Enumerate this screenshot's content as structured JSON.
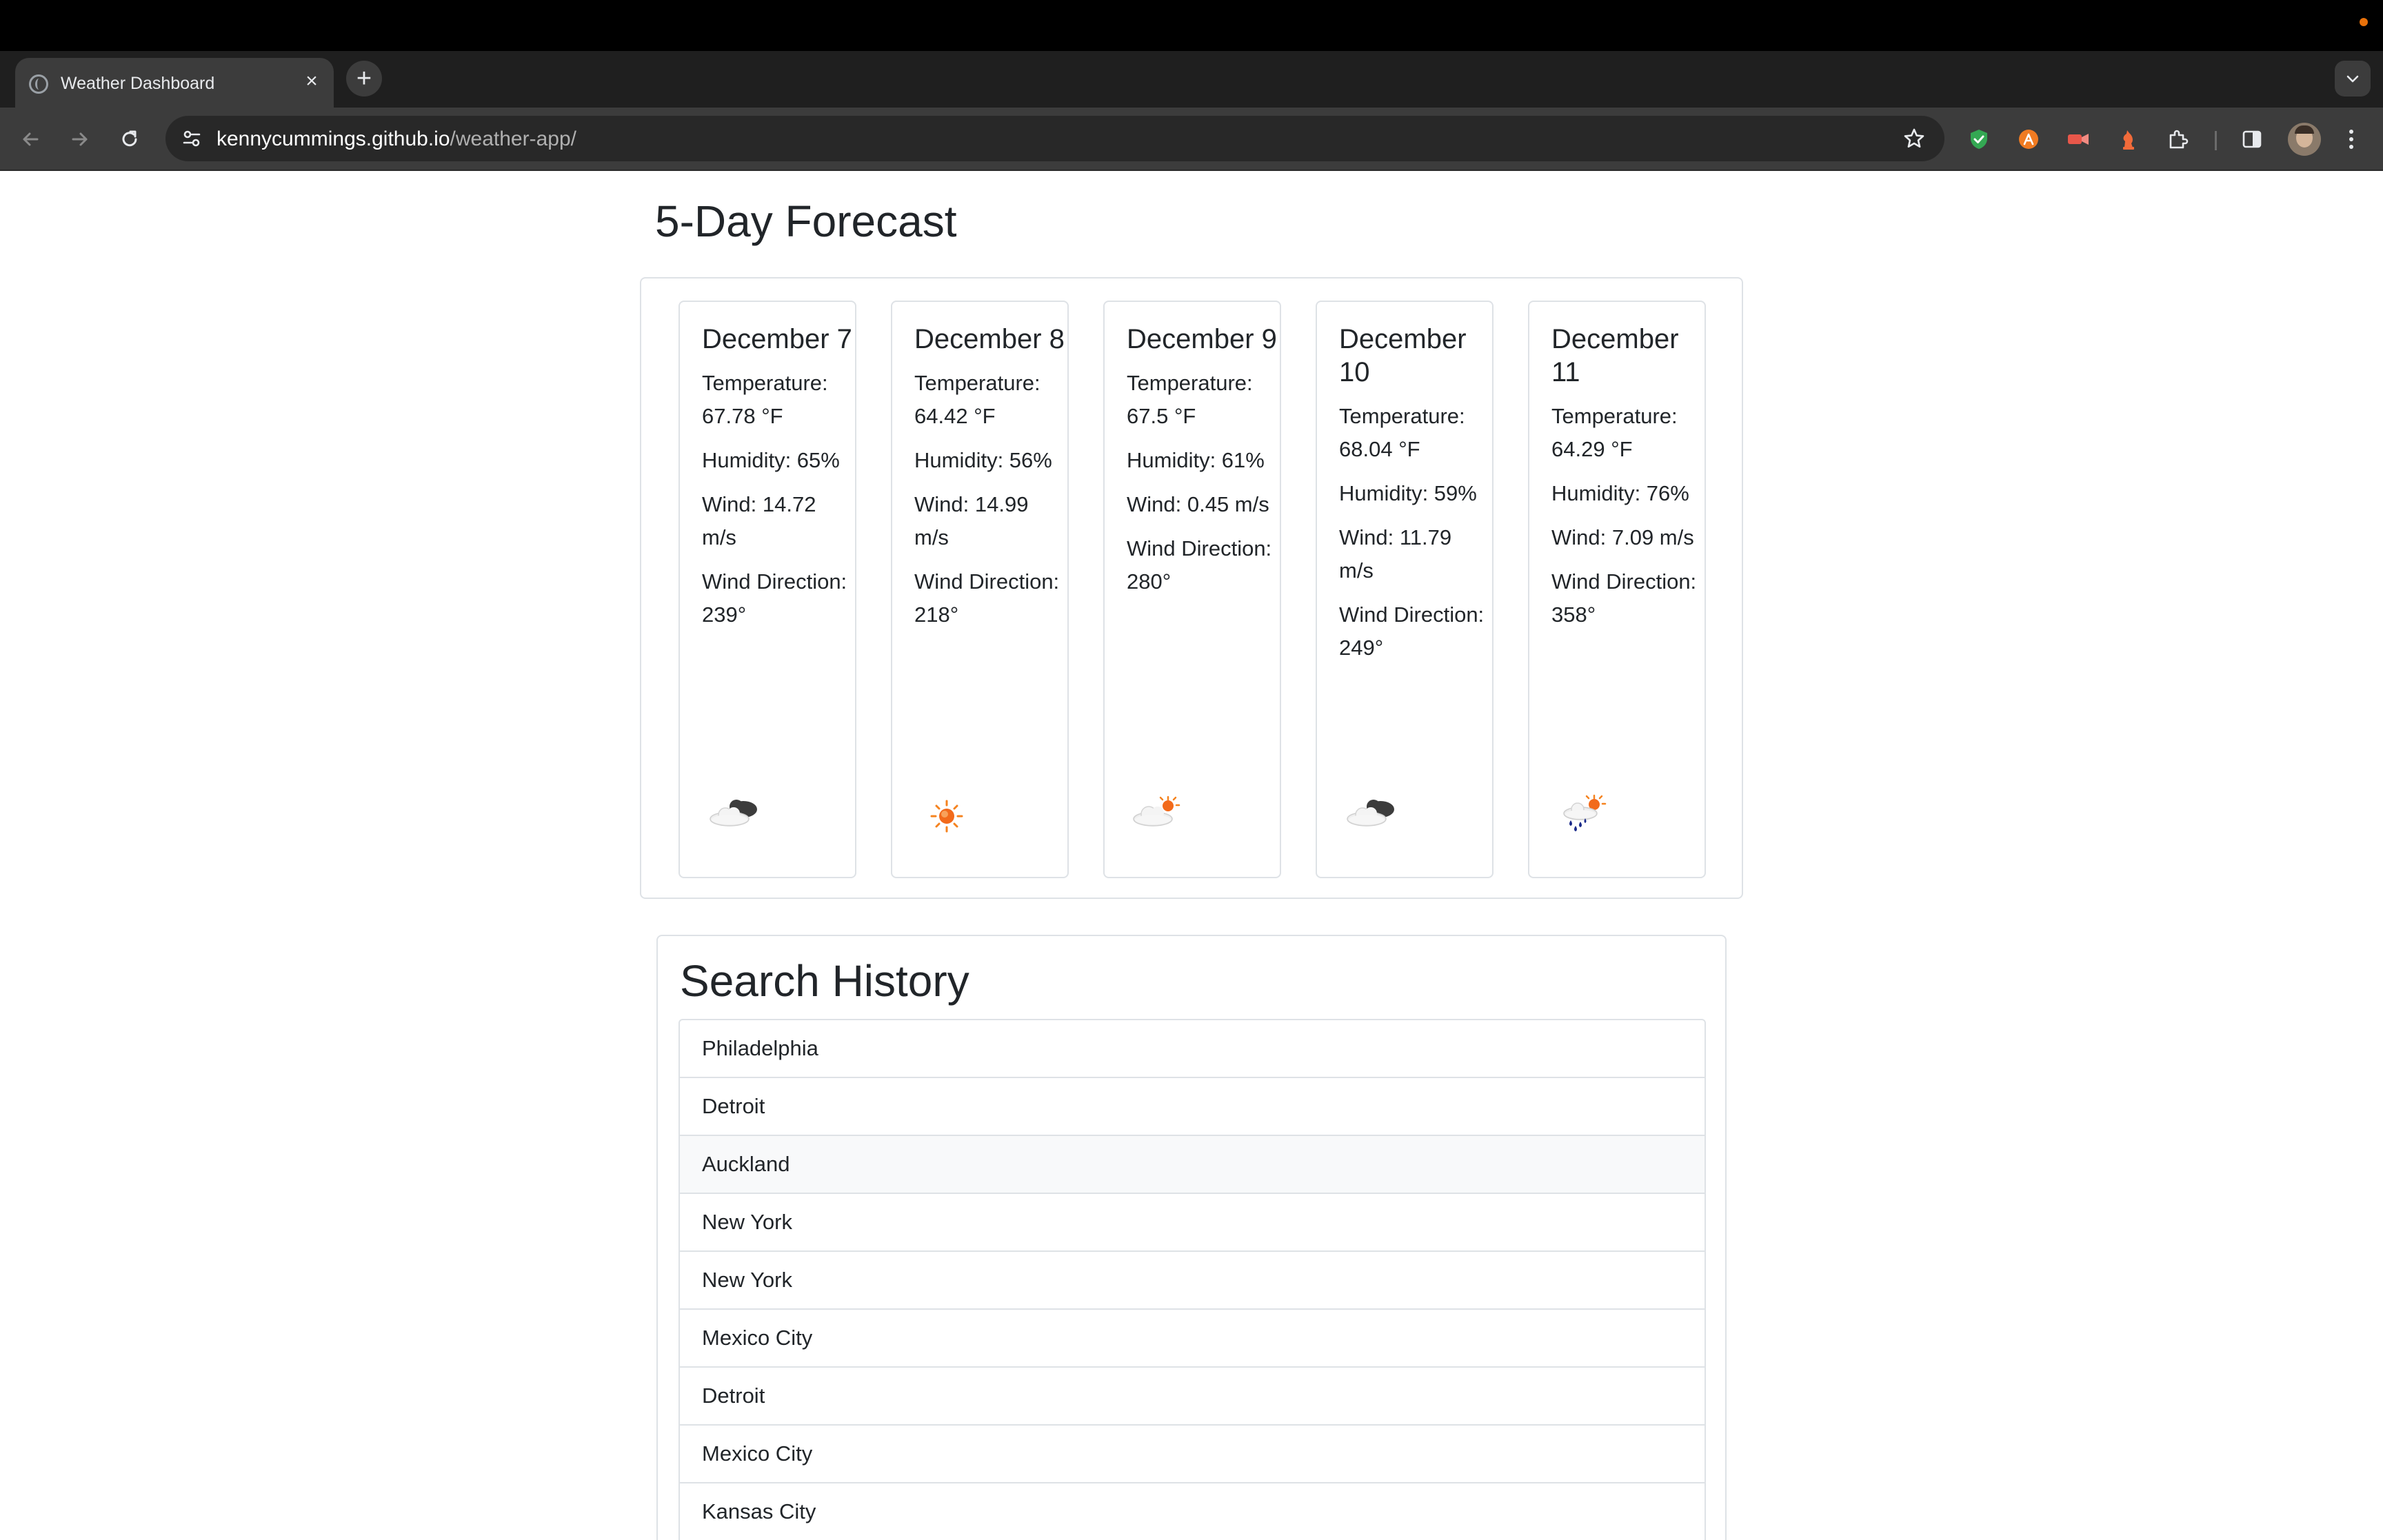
{
  "browser": {
    "tab_title": "Weather Dashboard",
    "tab_close": "×",
    "new_tab": "+",
    "url_host": "kennycummings.github.io",
    "url_path": "/weather-app/"
  },
  "forecast": {
    "heading": "5-Day Forecast",
    "days": [
      {
        "date": "December 7",
        "temperature": "Temperature: 67.78 °F",
        "humidity": "Humidity: 65%",
        "wind": "Wind: 14.72 m/s",
        "wind_direction": "Wind Direction: 239°",
        "icon": "broken-clouds-icon"
      },
      {
        "date": "December 8",
        "temperature": "Temperature: 64.42 °F",
        "humidity": "Humidity: 56%",
        "wind": "Wind: 14.99 m/s",
        "wind_direction": "Wind Direction: 218°",
        "icon": "clear-sky-icon"
      },
      {
        "date": "December 9",
        "temperature": "Temperature: 67.5 °F",
        "humidity": "Humidity: 61%",
        "wind": "Wind: 0.45 m/s",
        "wind_direction": "Wind Direction: 280°",
        "icon": "few-clouds-icon"
      },
      {
        "date": "December 10",
        "temperature": "Temperature: 68.04 °F",
        "humidity": "Humidity: 59%",
        "wind": "Wind: 11.79 m/s",
        "wind_direction": "Wind Direction: 249°",
        "icon": "broken-clouds-icon"
      },
      {
        "date": "December 11",
        "temperature": "Temperature: 64.29 °F",
        "humidity": "Humidity: 76%",
        "wind": "Wind: 7.09 m/s",
        "wind_direction": "Wind Direction: 358°",
        "icon": "rain-icon"
      }
    ]
  },
  "history": {
    "heading": "Search History",
    "items": [
      "Philadelphia",
      "Detroit",
      "Auckland",
      "New York",
      "New York",
      "Mexico City",
      "Detroit",
      "Mexico City",
      "Kansas City"
    ],
    "hovered_index": 2
  },
  "colors": {
    "chrome_dark": "#1f1f1f",
    "toolbar": "#3c3c3c",
    "border": "#dee2e6",
    "text": "#212529",
    "sun": "#f5831f"
  }
}
